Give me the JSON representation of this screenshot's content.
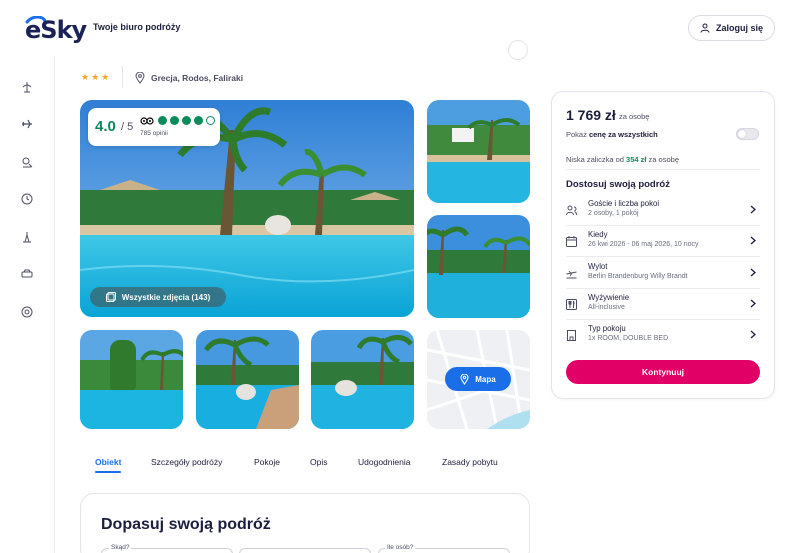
{
  "header": {
    "logo_text": "eSky",
    "tagline": "Twoje biuro podróży",
    "login_label": "Zaloguj się"
  },
  "hotel": {
    "stars": "★★★",
    "location": "Grecja, Rodos, Faliraki"
  },
  "rating": {
    "score": "4.0",
    "max": "/ 5",
    "reviews": "785 opinii",
    "dots_filled": 4,
    "dots_total": 5
  },
  "gallery": {
    "all_photos_label": "Wszystkie zdjęcia (143)",
    "map_label": "Mapa"
  },
  "tabs": [
    "Obiekt",
    "Szczegóły podróży",
    "Pokoje",
    "Opis",
    "Udogodnienia",
    "Zasady pobytu"
  ],
  "adjust": {
    "title": "Dopasuj swoją podróż",
    "field_from": "Skąd?",
    "field_people": "Ile osób?"
  },
  "booking": {
    "price": "1 769 zł",
    "price_sub": "za osobę",
    "toggle_prefix": "Pokaż ",
    "toggle_bold": "cenę za wszystkich",
    "deposit_prefix": "Niska zaliczka od ",
    "deposit_amount": "354 zł",
    "deposit_suffix": " za osobę",
    "customize_title": "Dostosuj swoją podróż",
    "options": [
      {
        "title": "Goście i liczba pokoi",
        "sub": "2 osoby, 1 pokój",
        "icon": "guests-icon"
      },
      {
        "title": "Kiedy",
        "sub": "26 kwi 2026 - 06 maj 2026, 10 nocy",
        "icon": "calendar-icon"
      },
      {
        "title": "Wylot",
        "sub": "Berlin Brandenburg Willy Brandt",
        "icon": "plane-icon"
      },
      {
        "title": "Wyżywienie",
        "sub": "All-inclusive",
        "icon": "cutlery-icon"
      },
      {
        "title": "Typ pokoju",
        "sub": "1x ROOM, DOUBLE BED",
        "icon": "room-icon"
      }
    ],
    "continue_label": "Kontynuuj"
  },
  "colors": {
    "brand_pink": "#e10066",
    "accent_blue": "#1a6fe8",
    "rating_green": "#0b8a5a",
    "navy": "#1a2258"
  }
}
